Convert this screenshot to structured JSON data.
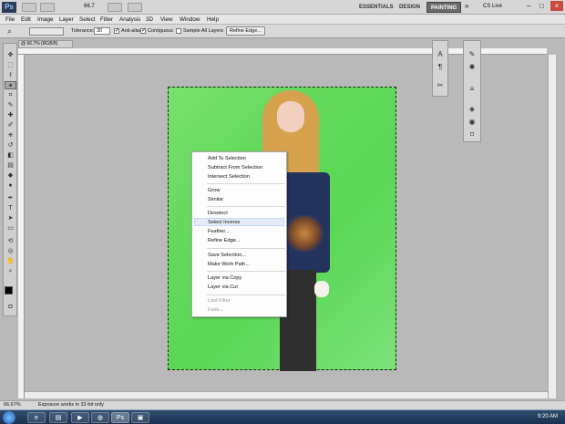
{
  "appbar": {
    "logo": "Ps",
    "zoom_value": "66.7",
    "workspaces": [
      "ESSENTIALS",
      "DESIGN",
      "PAINTING"
    ],
    "overflow": "»",
    "cs_live": "CS Live"
  },
  "menubar": [
    "File",
    "Edit",
    "Image",
    "Layer",
    "Select",
    "Filter",
    "Analysis",
    "3D",
    "View",
    "Window",
    "Help"
  ],
  "options": {
    "tolerance_label": "Tolerance:",
    "tolerance_value": "30",
    "anti_alias": "Anti-alias",
    "contiguous": "Contiguous",
    "sample_all_layers": "Sample All Layers",
    "refine_edge": "Refine Edge..."
  },
  "document": {
    "tab_title": "@ 66.7% (RGB/8)"
  },
  "context_menu": {
    "items": [
      {
        "label": "Add To Selection",
        "disabled": false
      },
      {
        "label": "Subtract From Selection",
        "disabled": false
      },
      {
        "label": "Intersect Selection",
        "disabled": false
      },
      {
        "label": "Grow",
        "disabled": false
      },
      {
        "label": "Similar",
        "disabled": false
      },
      {
        "label": "Deselect",
        "disabled": false
      },
      {
        "label": "Select Inverse",
        "disabled": false
      },
      {
        "label": "Feather...",
        "disabled": false
      },
      {
        "label": "Refine Edge...",
        "disabled": false
      },
      {
        "label": "Save Selection...",
        "disabled": false
      },
      {
        "label": "Make Work Path...",
        "disabled": false
      },
      {
        "label": "Layer via Copy",
        "disabled": false
      },
      {
        "label": "Layer via Cut",
        "disabled": false
      },
      {
        "label": "Last Filter",
        "disabled": true
      },
      {
        "label": "Fade...",
        "disabled": true
      }
    ],
    "hovered": "Select Inverse"
  },
  "statusbar": {
    "zoom": "66.67%",
    "message": "Exposure works in 32-bit only"
  },
  "taskbar": {
    "time": "9:20 AM"
  },
  "colors": {
    "canvas_green": "#62d85a",
    "menu_hover": "#e3ecf8"
  }
}
